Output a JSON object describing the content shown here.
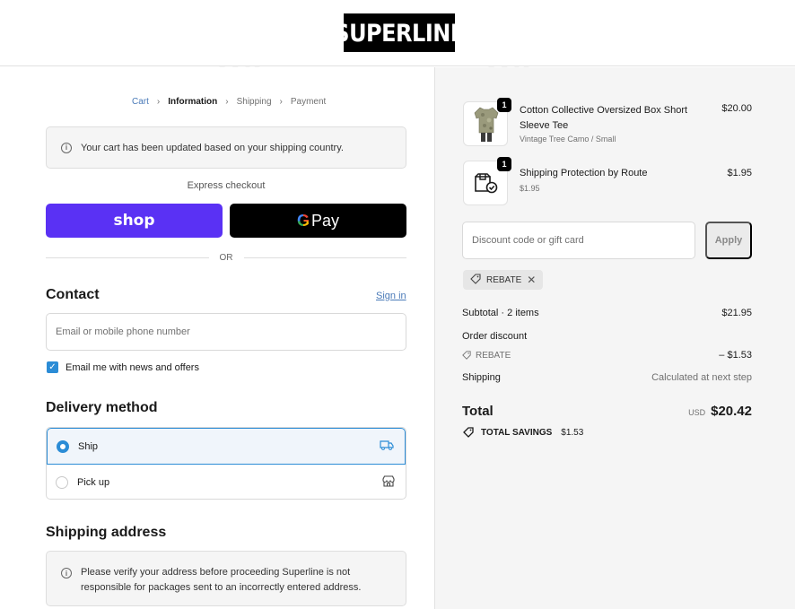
{
  "brand": {
    "logo_text": "SUPERLINE"
  },
  "breadcrumb": {
    "items": [
      {
        "label": "Cart",
        "state": "link"
      },
      {
        "label": "Information",
        "state": "current"
      },
      {
        "label": "Shipping",
        "state": "upcoming"
      },
      {
        "label": "Payment",
        "state": "upcoming"
      }
    ],
    "separator": "›"
  },
  "notices": {
    "cart_updated": "Your cart has been updated based on your shipping country.",
    "address_verify": "Please verify your address before proceeding Superline is not responsible for packages sent to an incorrectly entered address."
  },
  "express": {
    "label": "Express checkout",
    "shop_pay_label": "shop",
    "gpay_g": "G",
    "gpay_label": "Pay",
    "or_label": "OR"
  },
  "contact": {
    "title": "Contact",
    "sign_in": "Sign in",
    "email_placeholder": "Email or mobile phone number",
    "newsletter_label": "Email me with news and offers",
    "newsletter_checked": true
  },
  "delivery": {
    "title": "Delivery method",
    "options": [
      {
        "label": "Ship",
        "selected": true,
        "icon": "truck-icon"
      },
      {
        "label": "Pick up",
        "selected": false,
        "icon": "store-icon"
      }
    ]
  },
  "shipping_address": {
    "title": "Shipping address"
  },
  "order": {
    "items": [
      {
        "name": "Cotton Collective Oversized Box Short Sleeve Tee",
        "variant": "Vintage Tree Camo / Small",
        "price": "$20.00",
        "quantity": "1"
      },
      {
        "name": "Shipping Protection by Route",
        "variant": "$1.95",
        "price": "$1.95",
        "quantity": "1"
      }
    ],
    "discount_placeholder": "Discount code or gift card",
    "apply_label": "Apply",
    "applied_code": "REBATE",
    "subtotal_label": "Subtotal · 2 items",
    "subtotal_value": "$21.95",
    "order_discount_label": "Order discount",
    "discount_code_label": "REBATE",
    "discount_value": "– $1.53",
    "shipping_label": "Shipping",
    "shipping_value": "Calculated at next step",
    "total_label": "Total",
    "total_currency": "USD",
    "total_value": "$20.42",
    "savings_label": "TOTAL SAVINGS",
    "savings_value": "$1.53"
  },
  "colors": {
    "accent": "#2b8cd6",
    "shop_pay": "#5a31f4",
    "link": "#4a7ab8",
    "summary_bg": "#f5f5f5"
  }
}
